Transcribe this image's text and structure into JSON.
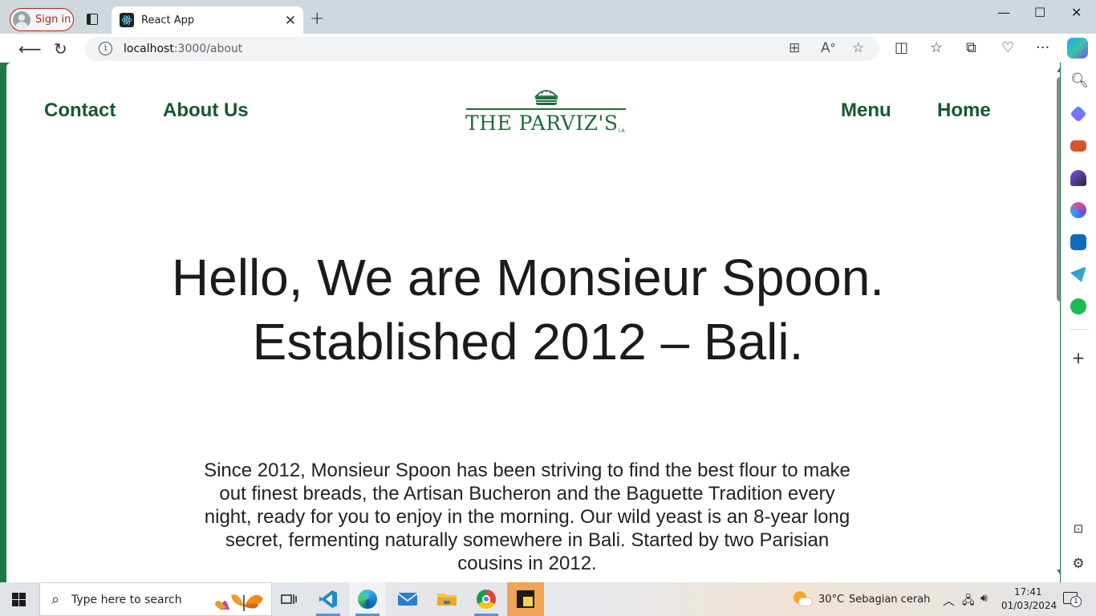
{
  "browser": {
    "signin_label": "Sign in",
    "tab_title": "React App",
    "url_host": "localhost",
    "url_rest": ":3000/about"
  },
  "site": {
    "nav_left": [
      "Contact",
      "About Us"
    ],
    "nav_right": [
      "Menu",
      "Home"
    ],
    "logo_text": "THE PARVIZ'S",
    "logo_small": "LA",
    "hero_line1": "Hello, We are Monsieur Spoon.",
    "hero_line2": "Established 2012 – Bali.",
    "intro": "Since 2012, Monsieur Spoon has been striving to find the best flour to make out finest breads, the Artisan Bucheron and the Baguette Tradition every night, ready for you to enjoy in the morning. Our wild yeast is an 8-year long secret, fermenting naturally somewhere in Bali. Started by two Parisian cousins in 2012.",
    "brand_color": "#14592f"
  },
  "taskbar": {
    "search_placeholder": "Type here to search",
    "weather_temp": "30°C",
    "weather_desc": "Sebagian cerah",
    "time": "17:41",
    "date": "01/03/2024",
    "notification_count": "1"
  }
}
